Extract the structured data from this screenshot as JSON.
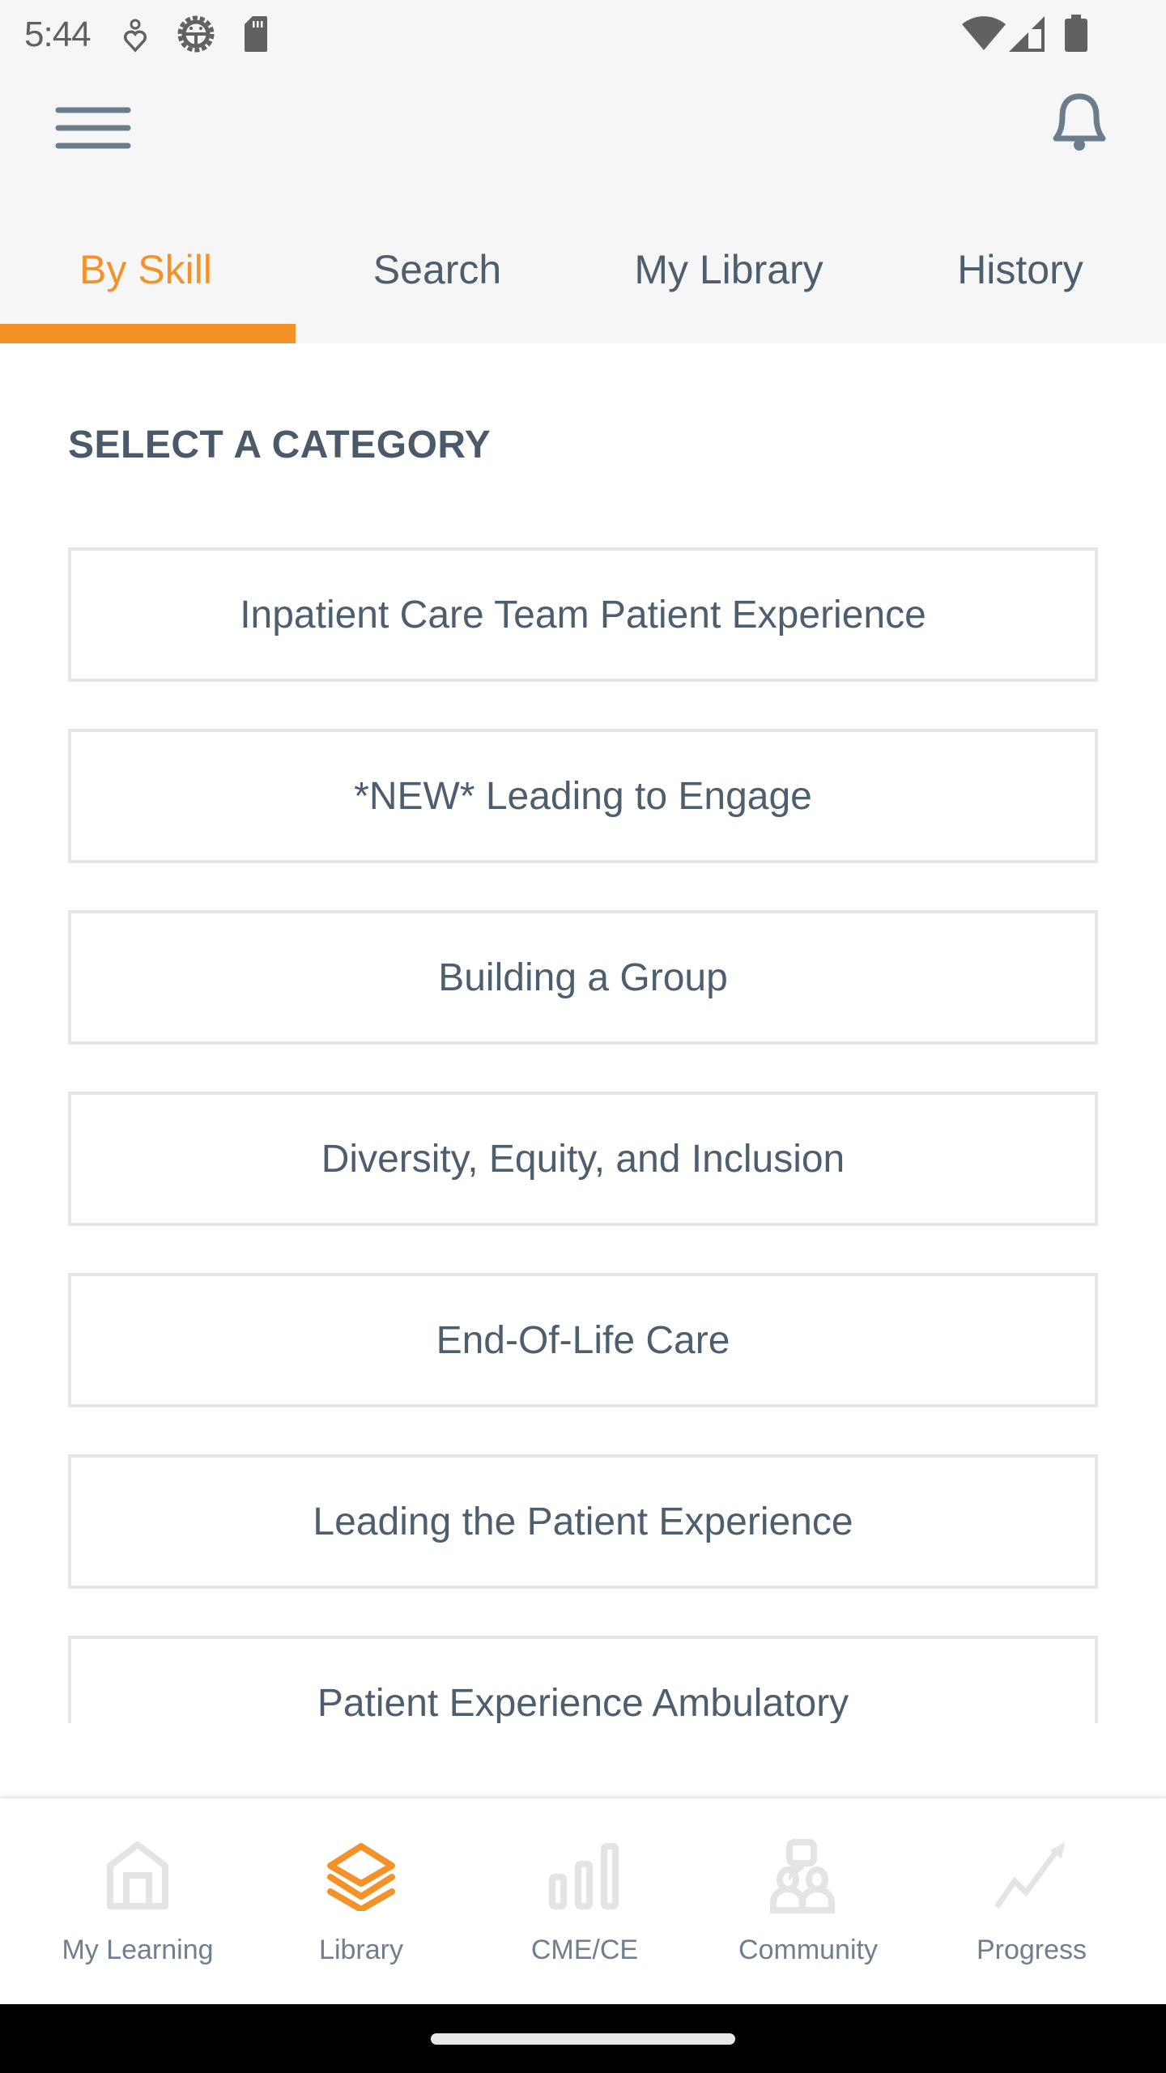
{
  "status_bar": {
    "time": "5:44",
    "left_icons": [
      "accessibility-heart-icon",
      "android-debug-icon",
      "sd-card-icon"
    ],
    "right_icons": [
      "wifi-icon",
      "cellular-signal-icon",
      "battery-icon"
    ]
  },
  "header": {
    "menu_icon": "hamburger-menu-icon",
    "notification_icon": "bell-icon"
  },
  "tabs": [
    {
      "label": "By Skill",
      "active": true
    },
    {
      "label": "Search",
      "active": false
    },
    {
      "label": "My Library",
      "active": false
    },
    {
      "label": "History",
      "active": false
    }
  ],
  "content": {
    "section_title": "SELECT A CATEGORY",
    "categories": [
      "Inpatient Care Team Patient Experience",
      "*NEW* Leading to Engage",
      "Building a Group",
      "Diversity, Equity, and Inclusion",
      "End-Of-Life Care",
      "Leading the Patient Experience",
      "Patient Experience Ambulatory"
    ]
  },
  "bottom_nav": [
    {
      "label": "My Learning",
      "icon": "home-icon",
      "active": false
    },
    {
      "label": "Library",
      "icon": "layers-icon",
      "active": true
    },
    {
      "label": "CME/CE",
      "icon": "bar-chart-icon",
      "active": false
    },
    {
      "label": "Community",
      "icon": "community-icon",
      "active": false
    },
    {
      "label": "Progress",
      "icon": "trend-up-icon",
      "active": false
    }
  ],
  "colors": {
    "accent": "#f4922a",
    "text": "#4d5e6e",
    "inactive_icon": "#e4e4e4",
    "card_border": "#e6e6e6",
    "header_bg": "#f6f6f6"
  }
}
